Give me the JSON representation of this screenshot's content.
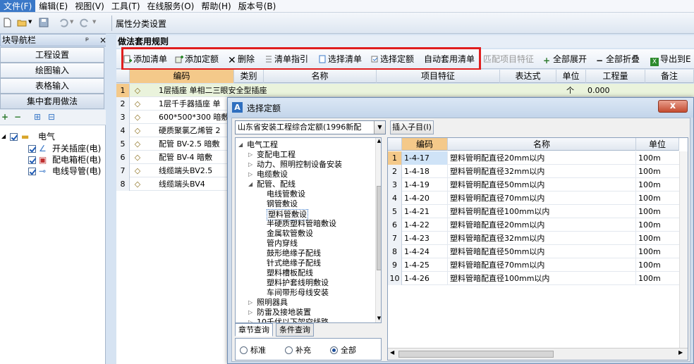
{
  "menu": [
    "文件(F)",
    "编辑(E)",
    "视图(V)",
    "工具(T)",
    "在线服务(O)",
    "帮助(H)",
    "版本号(B)"
  ],
  "quick_toolbar": {
    "tab_label": "属性分类设置"
  },
  "nav": {
    "title": "块导航栏",
    "pin": "ᵖ",
    "close": "×",
    "buttons": [
      "工程设置",
      "绘图输入",
      "表格输入",
      "集中套用做法"
    ],
    "tree_root": "电气",
    "tree_items": [
      "开关插座(电)",
      "配电箱柜(电)",
      "电线导管(电)"
    ]
  },
  "main": {
    "title": "做法套用规则",
    "toolbar": [
      "添加清单",
      "添加定额",
      "删除",
      "清单指引",
      "选择清单",
      "选择定额",
      "自动套用清单",
      "匹配项目特征",
      "全部展开",
      "全部折叠",
      "导出到E"
    ],
    "headers": [
      "编码",
      "类别",
      "名称",
      "项目特征",
      "表达式",
      "单位",
      "工程量",
      "备注"
    ],
    "rows": [
      {
        "n": "1",
        "name": "1层插座 单相二三眼安全型插座",
        "unit": "个",
        "qty": "0.000"
      },
      {
        "n": "2",
        "name": "1层千手器插座 单"
      },
      {
        "n": "3",
        "name": "600*500*300 暗敷"
      },
      {
        "n": "4",
        "name": "硬质聚氯乙烯管 2"
      },
      {
        "n": "5",
        "name": "配管 BV-2.5 暗敷"
      },
      {
        "n": "6",
        "name": "配管 BV-4 暗敷"
      },
      {
        "n": "7",
        "name": "线缆端头BV2.5"
      },
      {
        "n": "8",
        "name": "线缆端头BV4"
      }
    ]
  },
  "dialog": {
    "title": "选择定额",
    "close": "x",
    "library": "山东省安装工程综合定额(1996新配",
    "insert_label": "插入子目(I)",
    "tree": [
      {
        "label": "电气工程",
        "level": 0,
        "arrow": "open"
      },
      {
        "label": "变配电工程",
        "level": 1,
        "arrow": "closed"
      },
      {
        "label": "动力、照明控制设备安装",
        "level": 1,
        "arrow": "closed"
      },
      {
        "label": "电缆敷设",
        "level": 1,
        "arrow": "closed"
      },
      {
        "label": "配管、配线",
        "level": 1,
        "arrow": "open"
      },
      {
        "label": "电线管敷设",
        "level": 2
      },
      {
        "label": "钢管敷设",
        "level": 2
      },
      {
        "label": "塑料管敷设",
        "level": 2,
        "selected": true
      },
      {
        "label": "半硬质塑料管暗敷设",
        "level": 2
      },
      {
        "label": "金属软管敷设",
        "level": 2
      },
      {
        "label": "管内穿线",
        "level": 2
      },
      {
        "label": "鼓形绝缘子配线",
        "level": 2
      },
      {
        "label": "针式绝缘子配线",
        "level": 2
      },
      {
        "label": "塑料槽板配线",
        "level": 2
      },
      {
        "label": "塑料护套线明敷设",
        "level": 2
      },
      {
        "label": "车间带形母线安装",
        "level": 2
      },
      {
        "label": "照明器具",
        "level": 1,
        "arrow": "closed"
      },
      {
        "label": "防雷及接地装置",
        "level": 1,
        "arrow": "closed"
      },
      {
        "label": "10千伏以下架空线路",
        "level": 1,
        "arrow": "closed"
      }
    ],
    "tabs": [
      "章节查询",
      "条件查询"
    ],
    "radios": [
      "标准",
      "补充",
      "全部"
    ],
    "radio_selected": "全部",
    "table_headers": [
      "编码",
      "名称",
      "单位"
    ],
    "rows": [
      {
        "n": "1",
        "code": "1-4-17",
        "name": "塑料管明配直径20mm以内",
        "unit": "100m"
      },
      {
        "n": "2",
        "code": "1-4-18",
        "name": "塑料管明配直径32mm以内",
        "unit": "100m"
      },
      {
        "n": "3",
        "code": "1-4-19",
        "name": "塑料管明配直径50mm以内",
        "unit": "100m"
      },
      {
        "n": "4",
        "code": "1-4-20",
        "name": "塑料管明配直径70mm以内",
        "unit": "100m"
      },
      {
        "n": "5",
        "code": "1-4-21",
        "name": "塑料管明配直径100mm以内",
        "unit": "100m"
      },
      {
        "n": "6",
        "code": "1-4-22",
        "name": "塑料管暗配直径20mm以内",
        "unit": "100m"
      },
      {
        "n": "7",
        "code": "1-4-23",
        "name": "塑料管暗配直径32mm以内",
        "unit": "100m"
      },
      {
        "n": "8",
        "code": "1-4-24",
        "name": "塑料管暗配直径50mm以内",
        "unit": "100m"
      },
      {
        "n": "9",
        "code": "1-4-25",
        "name": "塑料管暗配直径70mm以内",
        "unit": "100m"
      },
      {
        "n": "10",
        "code": "1-4-26",
        "name": "塑料管暗配直径100mm以内",
        "unit": "100m"
      }
    ]
  }
}
